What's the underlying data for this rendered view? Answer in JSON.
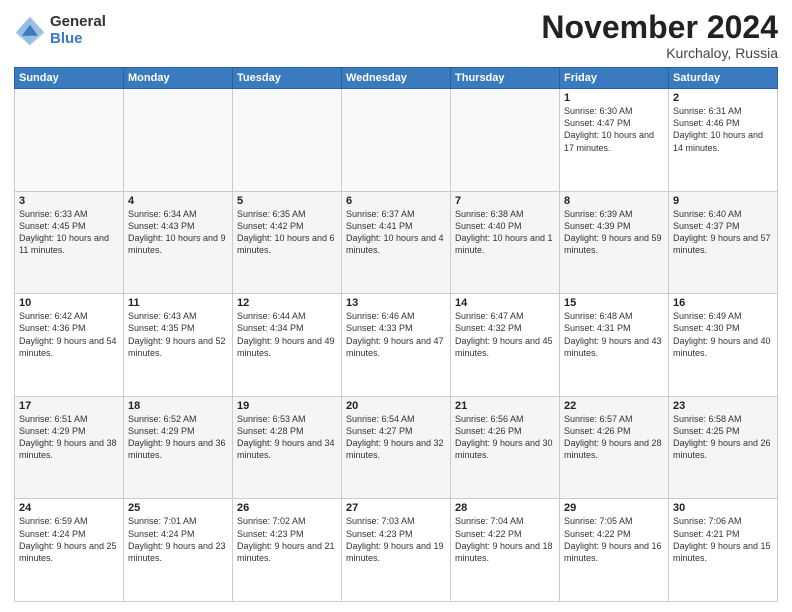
{
  "header": {
    "logo_general": "General",
    "logo_blue": "Blue",
    "month_title": "November 2024",
    "location": "Kurchaloy, Russia"
  },
  "weekdays": [
    "Sunday",
    "Monday",
    "Tuesday",
    "Wednesday",
    "Thursday",
    "Friday",
    "Saturday"
  ],
  "weeks": [
    [
      {
        "day": "",
        "info": ""
      },
      {
        "day": "",
        "info": ""
      },
      {
        "day": "",
        "info": ""
      },
      {
        "day": "",
        "info": ""
      },
      {
        "day": "",
        "info": ""
      },
      {
        "day": "1",
        "info": "Sunrise: 6:30 AM\nSunset: 4:47 PM\nDaylight: 10 hours and 17 minutes."
      },
      {
        "day": "2",
        "info": "Sunrise: 6:31 AM\nSunset: 4:46 PM\nDaylight: 10 hours and 14 minutes."
      }
    ],
    [
      {
        "day": "3",
        "info": "Sunrise: 6:33 AM\nSunset: 4:45 PM\nDaylight: 10 hours and 11 minutes."
      },
      {
        "day": "4",
        "info": "Sunrise: 6:34 AM\nSunset: 4:43 PM\nDaylight: 10 hours and 9 minutes."
      },
      {
        "day": "5",
        "info": "Sunrise: 6:35 AM\nSunset: 4:42 PM\nDaylight: 10 hours and 6 minutes."
      },
      {
        "day": "6",
        "info": "Sunrise: 6:37 AM\nSunset: 4:41 PM\nDaylight: 10 hours and 4 minutes."
      },
      {
        "day": "7",
        "info": "Sunrise: 6:38 AM\nSunset: 4:40 PM\nDaylight: 10 hours and 1 minute."
      },
      {
        "day": "8",
        "info": "Sunrise: 6:39 AM\nSunset: 4:39 PM\nDaylight: 9 hours and 59 minutes."
      },
      {
        "day": "9",
        "info": "Sunrise: 6:40 AM\nSunset: 4:37 PM\nDaylight: 9 hours and 57 minutes."
      }
    ],
    [
      {
        "day": "10",
        "info": "Sunrise: 6:42 AM\nSunset: 4:36 PM\nDaylight: 9 hours and 54 minutes."
      },
      {
        "day": "11",
        "info": "Sunrise: 6:43 AM\nSunset: 4:35 PM\nDaylight: 9 hours and 52 minutes."
      },
      {
        "day": "12",
        "info": "Sunrise: 6:44 AM\nSunset: 4:34 PM\nDaylight: 9 hours and 49 minutes."
      },
      {
        "day": "13",
        "info": "Sunrise: 6:46 AM\nSunset: 4:33 PM\nDaylight: 9 hours and 47 minutes."
      },
      {
        "day": "14",
        "info": "Sunrise: 6:47 AM\nSunset: 4:32 PM\nDaylight: 9 hours and 45 minutes."
      },
      {
        "day": "15",
        "info": "Sunrise: 6:48 AM\nSunset: 4:31 PM\nDaylight: 9 hours and 43 minutes."
      },
      {
        "day": "16",
        "info": "Sunrise: 6:49 AM\nSunset: 4:30 PM\nDaylight: 9 hours and 40 minutes."
      }
    ],
    [
      {
        "day": "17",
        "info": "Sunrise: 6:51 AM\nSunset: 4:29 PM\nDaylight: 9 hours and 38 minutes."
      },
      {
        "day": "18",
        "info": "Sunrise: 6:52 AM\nSunset: 4:29 PM\nDaylight: 9 hours and 36 minutes."
      },
      {
        "day": "19",
        "info": "Sunrise: 6:53 AM\nSunset: 4:28 PM\nDaylight: 9 hours and 34 minutes."
      },
      {
        "day": "20",
        "info": "Sunrise: 6:54 AM\nSunset: 4:27 PM\nDaylight: 9 hours and 32 minutes."
      },
      {
        "day": "21",
        "info": "Sunrise: 6:56 AM\nSunset: 4:26 PM\nDaylight: 9 hours and 30 minutes."
      },
      {
        "day": "22",
        "info": "Sunrise: 6:57 AM\nSunset: 4:26 PM\nDaylight: 9 hours and 28 minutes."
      },
      {
        "day": "23",
        "info": "Sunrise: 6:58 AM\nSunset: 4:25 PM\nDaylight: 9 hours and 26 minutes."
      }
    ],
    [
      {
        "day": "24",
        "info": "Sunrise: 6:59 AM\nSunset: 4:24 PM\nDaylight: 9 hours and 25 minutes."
      },
      {
        "day": "25",
        "info": "Sunrise: 7:01 AM\nSunset: 4:24 PM\nDaylight: 9 hours and 23 minutes."
      },
      {
        "day": "26",
        "info": "Sunrise: 7:02 AM\nSunset: 4:23 PM\nDaylight: 9 hours and 21 minutes."
      },
      {
        "day": "27",
        "info": "Sunrise: 7:03 AM\nSunset: 4:23 PM\nDaylight: 9 hours and 19 minutes."
      },
      {
        "day": "28",
        "info": "Sunrise: 7:04 AM\nSunset: 4:22 PM\nDaylight: 9 hours and 18 minutes."
      },
      {
        "day": "29",
        "info": "Sunrise: 7:05 AM\nSunset: 4:22 PM\nDaylight: 9 hours and 16 minutes."
      },
      {
        "day": "30",
        "info": "Sunrise: 7:06 AM\nSunset: 4:21 PM\nDaylight: 9 hours and 15 minutes."
      }
    ]
  ]
}
